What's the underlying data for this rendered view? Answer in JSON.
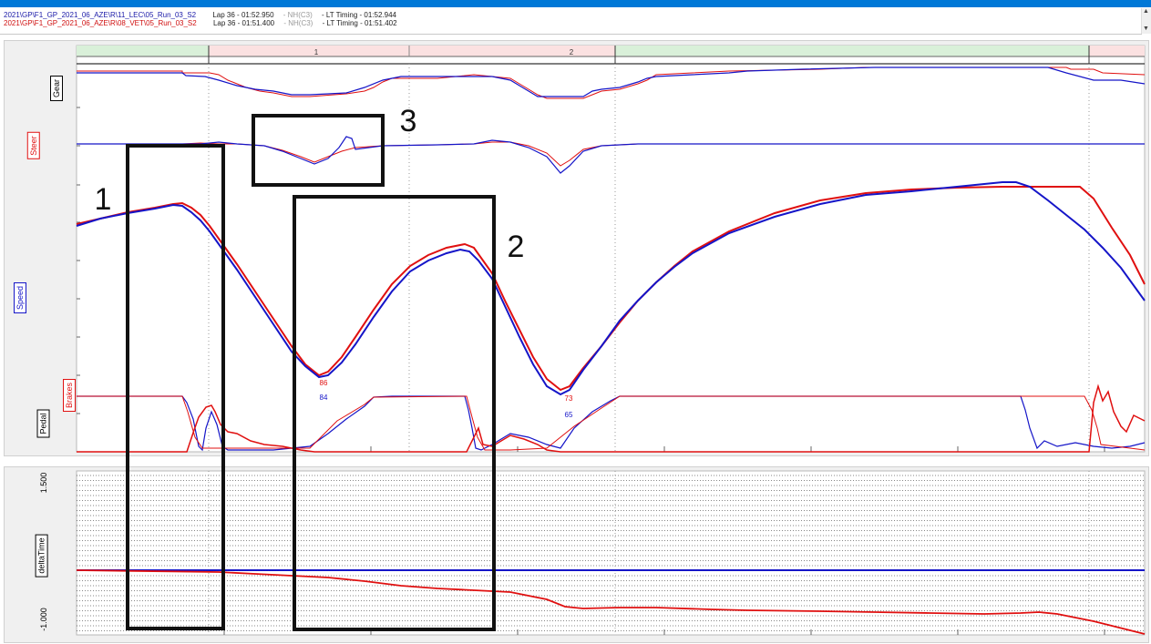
{
  "header": {
    "rows": [
      {
        "id": "2021\\GP\\F1_GP_2021_06_AZE\\R\\11_LEC\\05_Run_03_S2",
        "lap": "Lap 36 - 01:52.950",
        "nh": "- NH(C3)",
        "lt": "- LT Timing - 01:52.944",
        "color": "#1a1aa8"
      },
      {
        "id": "2021\\GP\\F1_GP_2021_06_AZE\\R\\08_VET\\05_Run_03_S2",
        "lap": "Lap 36 - 01:51.400",
        "nh": "- NH(C3)",
        "lt": "- LT Timing - 01:51.402",
        "color": "#d01010"
      }
    ]
  },
  "colors": {
    "blue": "#1515c8",
    "red": "#e01010",
    "accent": "#0078d7"
  },
  "channels": {
    "gear": "Gear",
    "steer": "Steer",
    "speed": "Speed",
    "brakes": "Brakes",
    "pedal": "Pedal",
    "delta": "deltaTime"
  },
  "sectors": [
    "1",
    "2"
  ],
  "delta_ticks": [
    "1.500",
    "-1.000"
  ],
  "annotations": {
    "box1": "1",
    "box2": "2",
    "box3": "3"
  },
  "chart_data": {
    "type": "line",
    "speed_minimums": [
      {
        "label": "86",
        "series": "red"
      },
      {
        "label": "84",
        "series": "blue"
      },
      {
        "label": "73",
        "series": "red"
      },
      {
        "label": "65",
        "series": "blue"
      }
    ],
    "delta_ylim": [
      -1.0,
      1.5
    ],
    "grid": true
  }
}
